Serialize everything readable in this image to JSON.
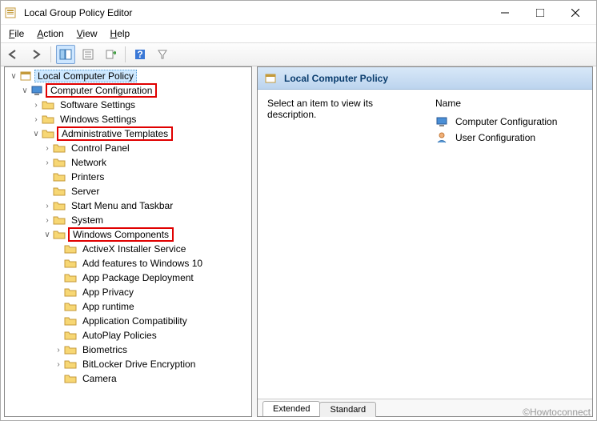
{
  "window": {
    "title": "Local Group Policy Editor"
  },
  "menu": {
    "file": "File",
    "action": "Action",
    "view": "View",
    "help": "Help"
  },
  "tree": {
    "root": "Local Computer Policy",
    "comp_config": "Computer Configuration",
    "software": "Software Settings",
    "windows_set": "Windows Settings",
    "admin_templ": "Administrative Templates",
    "control_panel": "Control Panel",
    "network": "Network",
    "printers": "Printers",
    "server": "Server",
    "startmenu": "Start Menu and Taskbar",
    "system": "System",
    "win_components": "Windows Components",
    "activex": "ActiveX Installer Service",
    "addfeat": "Add features to Windows 10",
    "apppkg": "App Package Deployment",
    "apppriv": "App Privacy",
    "apprun": "App runtime",
    "appcompat": "Application Compatibility",
    "autoplay": "AutoPlay Policies",
    "biometrics": "Biometrics",
    "bitlocker": "BitLocker Drive Encryption",
    "camera": "Camera"
  },
  "right": {
    "header": "Local Computer Policy",
    "desc": "Select an item to view its description.",
    "col_name": "Name",
    "item1": "Computer Configuration",
    "item2": "User Configuration",
    "tab_ext": "Extended",
    "tab_std": "Standard"
  },
  "watermark": "©Howtoconnect"
}
